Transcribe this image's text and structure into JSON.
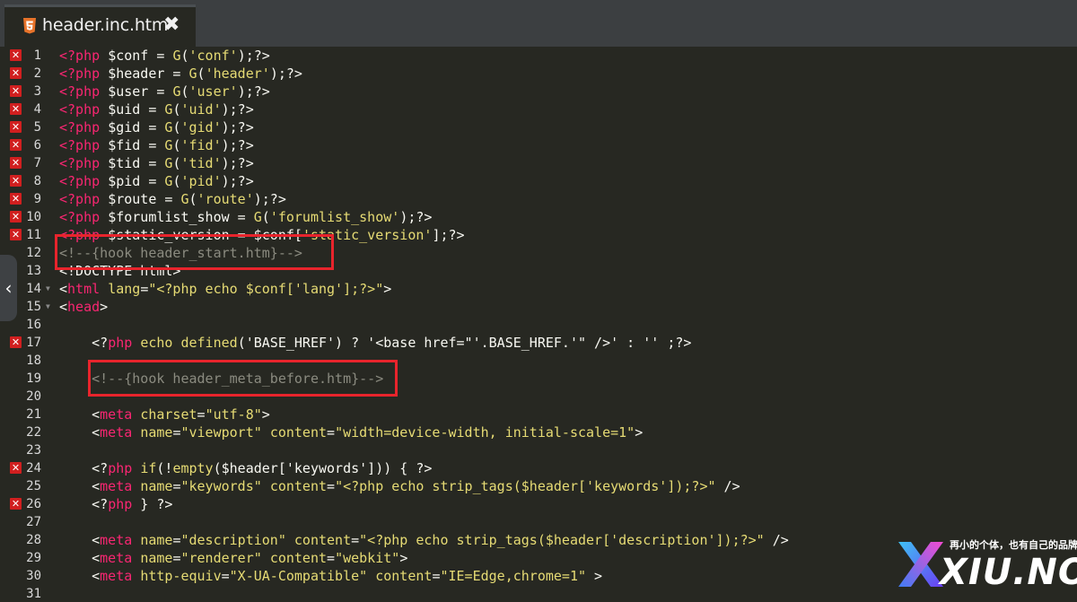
{
  "tab": {
    "title": "header.inc.htm",
    "close": "✖"
  },
  "lines": [
    {
      "n": "1",
      "err": true,
      "fold": "",
      "seg": [
        [
          "kw",
          "<?php "
        ],
        [
          "t",
          "$conf = "
        ],
        [
          "fn",
          "G"
        ],
        [
          "t",
          "("
        ],
        [
          "str",
          "'conf'"
        ],
        [
          "t",
          ");?>"
        ]
      ]
    },
    {
      "n": "2",
      "err": true,
      "fold": "",
      "seg": [
        [
          "kw",
          "<?php "
        ],
        [
          "t",
          "$header = "
        ],
        [
          "fn",
          "G"
        ],
        [
          "t",
          "("
        ],
        [
          "str",
          "'header'"
        ],
        [
          "t",
          ");?>"
        ]
      ]
    },
    {
      "n": "3",
      "err": true,
      "fold": "",
      "seg": [
        [
          "kw",
          "<?php "
        ],
        [
          "t",
          "$user = "
        ],
        [
          "fn",
          "G"
        ],
        [
          "t",
          "("
        ],
        [
          "str",
          "'user'"
        ],
        [
          "t",
          ");?>"
        ]
      ]
    },
    {
      "n": "4",
      "err": true,
      "fold": "",
      "seg": [
        [
          "kw",
          "<?php "
        ],
        [
          "t",
          "$uid = "
        ],
        [
          "fn",
          "G"
        ],
        [
          "t",
          "("
        ],
        [
          "str",
          "'uid'"
        ],
        [
          "t",
          ");?>"
        ]
      ]
    },
    {
      "n": "5",
      "err": true,
      "fold": "",
      "seg": [
        [
          "kw",
          "<?php "
        ],
        [
          "t",
          "$gid = "
        ],
        [
          "fn",
          "G"
        ],
        [
          "t",
          "("
        ],
        [
          "str",
          "'gid'"
        ],
        [
          "t",
          ");?>"
        ]
      ]
    },
    {
      "n": "6",
      "err": true,
      "fold": "",
      "seg": [
        [
          "kw",
          "<?php "
        ],
        [
          "t",
          "$fid = "
        ],
        [
          "fn",
          "G"
        ],
        [
          "t",
          "("
        ],
        [
          "str",
          "'fid'"
        ],
        [
          "t",
          ");?>"
        ]
      ]
    },
    {
      "n": "7",
      "err": true,
      "fold": "",
      "seg": [
        [
          "kw",
          "<?php "
        ],
        [
          "t",
          "$tid = "
        ],
        [
          "fn",
          "G"
        ],
        [
          "t",
          "("
        ],
        [
          "str",
          "'tid'"
        ],
        [
          "t",
          ");?>"
        ]
      ]
    },
    {
      "n": "8",
      "err": true,
      "fold": "",
      "seg": [
        [
          "kw",
          "<?php "
        ],
        [
          "t",
          "$pid = "
        ],
        [
          "fn",
          "G"
        ],
        [
          "t",
          "("
        ],
        [
          "str",
          "'pid'"
        ],
        [
          "t",
          ");?>"
        ]
      ]
    },
    {
      "n": "9",
      "err": true,
      "fold": "",
      "seg": [
        [
          "kw",
          "<?php "
        ],
        [
          "t",
          "$route = "
        ],
        [
          "fn",
          "G"
        ],
        [
          "t",
          "("
        ],
        [
          "str",
          "'route'"
        ],
        [
          "t",
          ");?>"
        ]
      ]
    },
    {
      "n": "10",
      "err": true,
      "fold": "",
      "seg": [
        [
          "kw",
          "<?php "
        ],
        [
          "t",
          "$forumlist_show = "
        ],
        [
          "fn",
          "G"
        ],
        [
          "t",
          "("
        ],
        [
          "str",
          "'forumlist_show'"
        ],
        [
          "t",
          ");?>"
        ]
      ]
    },
    {
      "n": "11",
      "err": true,
      "fold": "",
      "seg": [
        [
          "kw",
          "<?php "
        ],
        [
          "t",
          "$static_version = $conf["
        ],
        [
          "str",
          "'static_version'"
        ],
        [
          "t",
          "];?>"
        ]
      ]
    },
    {
      "n": "12",
      "err": false,
      "fold": "",
      "seg": [
        [
          "cmt",
          "<!--{hook header_start.htm}-->"
        ]
      ]
    },
    {
      "n": "13",
      "err": false,
      "fold": "",
      "seg": [
        [
          "t",
          "<!DOCTYPE html>"
        ]
      ]
    },
    {
      "n": "14",
      "err": false,
      "fold": "▼",
      "seg": [
        [
          "t",
          "<"
        ],
        [
          "kw",
          "html"
        ],
        [
          "t",
          " "
        ],
        [
          "fn",
          "lang"
        ],
        [
          "t",
          "="
        ],
        [
          "str",
          "\"<?php echo $conf['lang'];?>\""
        ],
        [
          "t",
          ">"
        ]
      ]
    },
    {
      "n": "15",
      "err": false,
      "fold": "▼",
      "seg": [
        [
          "t",
          "<"
        ],
        [
          "kw",
          "head"
        ],
        [
          "t",
          ">"
        ]
      ]
    },
    {
      "n": "16",
      "err": false,
      "fold": "",
      "seg": []
    },
    {
      "n": "17",
      "err": true,
      "fold": "",
      "seg": [
        [
          "t",
          "    <?"
        ],
        [
          "kw",
          "php"
        ],
        [
          "t",
          " "
        ],
        [
          "fn",
          "echo"
        ],
        [
          "t",
          " "
        ],
        [
          "fn",
          "defined"
        ],
        [
          "t",
          "('BASE_HREF') ? '<base href=\"'.BASE_HREF.'\" />' : '' ;?>"
        ]
      ]
    },
    {
      "n": "18",
      "err": false,
      "fold": "",
      "seg": []
    },
    {
      "n": "19",
      "err": false,
      "fold": "",
      "seg": [
        [
          "cmt",
          "    <!--{hook header_meta_before.htm}-->"
        ]
      ]
    },
    {
      "n": "20",
      "err": false,
      "fold": "",
      "seg": []
    },
    {
      "n": "21",
      "err": false,
      "fold": "",
      "seg": [
        [
          "t",
          "    <"
        ],
        [
          "kw",
          "meta"
        ],
        [
          "t",
          " "
        ],
        [
          "fn",
          "charset"
        ],
        [
          "t",
          "="
        ],
        [
          "str",
          "\"utf-8\""
        ],
        [
          "t",
          ">"
        ]
      ]
    },
    {
      "n": "22",
      "err": false,
      "fold": "",
      "seg": [
        [
          "t",
          "    <"
        ],
        [
          "kw",
          "meta"
        ],
        [
          "t",
          " "
        ],
        [
          "fn",
          "name"
        ],
        [
          "t",
          "="
        ],
        [
          "str",
          "\"viewport\""
        ],
        [
          "t",
          " "
        ],
        [
          "fn",
          "content"
        ],
        [
          "t",
          "="
        ],
        [
          "str",
          "\"width=device-width, initial-scale=1\""
        ],
        [
          "t",
          ">"
        ]
      ]
    },
    {
      "n": "23",
      "err": false,
      "fold": "",
      "seg": []
    },
    {
      "n": "24",
      "err": true,
      "fold": "",
      "seg": [
        [
          "t",
          "    <?"
        ],
        [
          "kw",
          "php"
        ],
        [
          "t",
          " "
        ],
        [
          "fn",
          "if"
        ],
        [
          "t",
          "(!"
        ],
        [
          "fn",
          "empty"
        ],
        [
          "t",
          "($header['keywords'])) { ?>"
        ]
      ]
    },
    {
      "n": "25",
      "err": false,
      "fold": "",
      "seg": [
        [
          "t",
          "    <"
        ],
        [
          "kw",
          "meta"
        ],
        [
          "t",
          " "
        ],
        [
          "fn",
          "name"
        ],
        [
          "t",
          "="
        ],
        [
          "str",
          "\"keywords\""
        ],
        [
          "t",
          " "
        ],
        [
          "fn",
          "content"
        ],
        [
          "t",
          "="
        ],
        [
          "str",
          "\"<?php echo strip_tags($header['keywords']);?>\""
        ],
        [
          "t",
          " />"
        ]
      ]
    },
    {
      "n": "26",
      "err": true,
      "fold": "",
      "seg": [
        [
          "t",
          "    <?"
        ],
        [
          "kw",
          "php"
        ],
        [
          "t",
          " } ?>"
        ]
      ]
    },
    {
      "n": "27",
      "err": false,
      "fold": "",
      "seg": []
    },
    {
      "n": "28",
      "err": false,
      "fold": "",
      "seg": [
        [
          "t",
          "    <"
        ],
        [
          "kw",
          "meta"
        ],
        [
          "t",
          " "
        ],
        [
          "fn",
          "name"
        ],
        [
          "t",
          "="
        ],
        [
          "str",
          "\"description\""
        ],
        [
          "t",
          " "
        ],
        [
          "fn",
          "content"
        ],
        [
          "t",
          "="
        ],
        [
          "str",
          "\"<?php echo strip_tags($header['description']);?>\""
        ],
        [
          "t",
          " />"
        ]
      ]
    },
    {
      "n": "29",
      "err": false,
      "fold": "",
      "seg": [
        [
          "t",
          "    <"
        ],
        [
          "kw",
          "meta"
        ],
        [
          "t",
          " "
        ],
        [
          "fn",
          "name"
        ],
        [
          "t",
          "="
        ],
        [
          "str",
          "\"renderer\""
        ],
        [
          "t",
          " "
        ],
        [
          "fn",
          "content"
        ],
        [
          "t",
          "="
        ],
        [
          "str",
          "\"webkit\""
        ],
        [
          "t",
          ">"
        ]
      ]
    },
    {
      "n": "30",
      "err": false,
      "fold": "",
      "seg": [
        [
          "t",
          "    <"
        ],
        [
          "kw",
          "meta"
        ],
        [
          "t",
          " "
        ],
        [
          "fn",
          "http-equiv"
        ],
        [
          "t",
          "="
        ],
        [
          "str",
          "\"X-UA-Compatible\""
        ],
        [
          "t",
          " "
        ],
        [
          "fn",
          "content"
        ],
        [
          "t",
          "="
        ],
        [
          "str",
          "\"IE=Edge,chrome=1\""
        ],
        [
          "t",
          " >"
        ]
      ]
    },
    {
      "n": "31",
      "err": false,
      "fold": "",
      "seg": []
    }
  ],
  "error_marker": "✕",
  "watermark": {
    "slogan": "再小的个体，也有自己的品牌",
    "brand": "XIU.NO"
  },
  "colors": {
    "error": "#d11f1f",
    "highlight_box": "#e8242c",
    "keyword": "#f92672",
    "string": "#e6db74"
  }
}
